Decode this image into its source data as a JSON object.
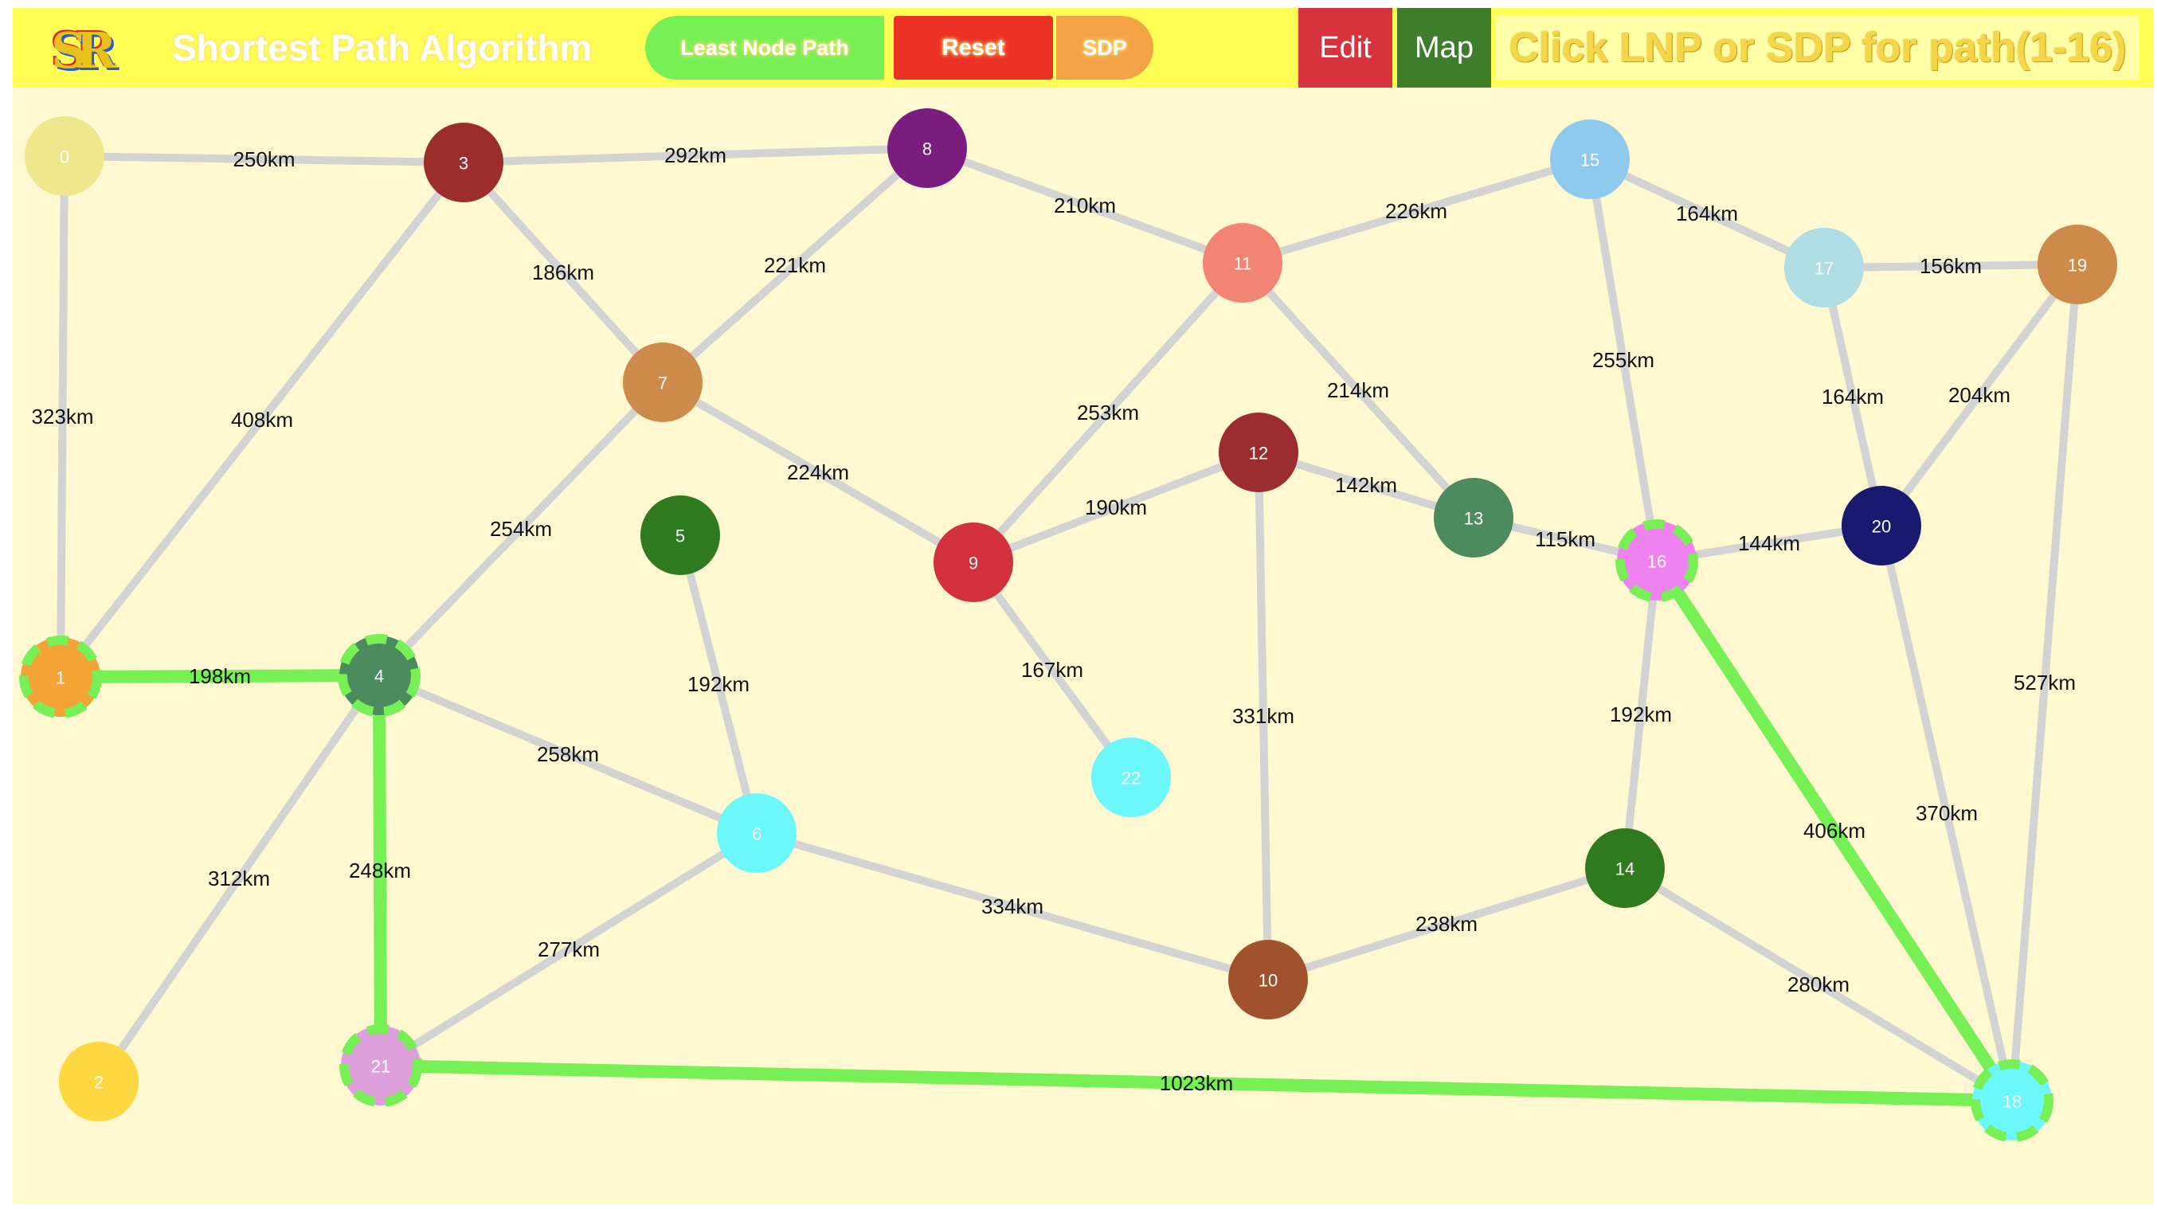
{
  "app": {
    "logo_text": "SR",
    "title": "Shortest Path Algorithm"
  },
  "toolbar": {
    "lnp_label": "Least Node Path",
    "reset_label": "Reset",
    "sdp_label": "SDP",
    "edit_label": "Edit",
    "map_label": "Map",
    "status_text": "Click LNP or SDP for path(1-16)"
  },
  "colors": {
    "toolbar_bg": "#ffff55",
    "canvas_bg": "#fff8d0",
    "edge": "#d3d3d3",
    "path_highlight": "#77f055"
  },
  "graph": {
    "nodes": [
      {
        "id": "0",
        "label": "0",
        "color": "#f0e68c"
      },
      {
        "id": "1",
        "label": "1",
        "color": "#f4a437",
        "highlight": true
      },
      {
        "id": "2",
        "label": "2",
        "color": "#ffd740"
      },
      {
        "id": "3",
        "label": "3",
        "color": "#9b2d2d"
      },
      {
        "id": "4",
        "label": "4",
        "color": "#4b8b5d",
        "highlight": true
      },
      {
        "id": "5",
        "label": "5",
        "color": "#2f7a1f"
      },
      {
        "id": "6",
        "label": "6",
        "color": "#6cf7fb"
      },
      {
        "id": "7",
        "label": "7",
        "color": "#cd8a4a"
      },
      {
        "id": "8",
        "label": "8",
        "color": "#7b1d7e"
      },
      {
        "id": "9",
        "label": "9",
        "color": "#d3313e"
      },
      {
        "id": "10",
        "label": "10",
        "color": "#a0522d"
      },
      {
        "id": "11",
        "label": "11",
        "color": "#f28474"
      },
      {
        "id": "12",
        "label": "12",
        "color": "#9b2c2f"
      },
      {
        "id": "13",
        "label": "13",
        "color": "#4b8b5d"
      },
      {
        "id": "14",
        "label": "14",
        "color": "#2f7a1f"
      },
      {
        "id": "15",
        "label": "15",
        "color": "#8ecaee"
      },
      {
        "id": "16",
        "label": "16",
        "color": "#ee82ee",
        "highlight": true
      },
      {
        "id": "17",
        "label": "17",
        "color": "#aedde6"
      },
      {
        "id": "18",
        "label": "18",
        "color": "#6cf7fb",
        "highlight": true
      },
      {
        "id": "19",
        "label": "19",
        "color": "#cd8a4a"
      },
      {
        "id": "20",
        "label": "20",
        "color": "#191970"
      },
      {
        "id": "21",
        "label": "21",
        "color": "#dda0dd",
        "highlight": true
      },
      {
        "id": "22",
        "label": "22",
        "color": "#6cf7fb"
      }
    ],
    "edges": [
      {
        "from": "0",
        "to": "3",
        "label": "250km"
      },
      {
        "from": "0",
        "to": "1",
        "label": "323km"
      },
      {
        "from": "3",
        "to": "8",
        "label": "292km"
      },
      {
        "from": "3",
        "to": "7",
        "label": "186km"
      },
      {
        "from": "3",
        "to": "1",
        "label": "408km"
      },
      {
        "from": "8",
        "to": "7",
        "label": "221km"
      },
      {
        "from": "8",
        "to": "11",
        "label": "210km"
      },
      {
        "from": "11",
        "to": "15",
        "label": "226km"
      },
      {
        "from": "15",
        "to": "17",
        "label": "164km"
      },
      {
        "from": "17",
        "to": "19",
        "label": "156km"
      },
      {
        "from": "15",
        "to": "16",
        "label": "255km"
      },
      {
        "from": "11",
        "to": "13",
        "label": "214km"
      },
      {
        "from": "11",
        "to": "9",
        "label": "253km"
      },
      {
        "from": "7",
        "to": "9",
        "label": "224km"
      },
      {
        "from": "7",
        "to": "4",
        "label": "254km"
      },
      {
        "from": "9",
        "to": "12",
        "label": "190km"
      },
      {
        "from": "12",
        "to": "13",
        "label": "142km"
      },
      {
        "from": "13",
        "to": "16",
        "label": "115km"
      },
      {
        "from": "16",
        "to": "20",
        "label": "144km"
      },
      {
        "from": "17",
        "to": "20",
        "label": "164km"
      },
      {
        "from": "19",
        "to": "20",
        "label": "204km"
      },
      {
        "from": "19",
        "to": "18",
        "label": "527km"
      },
      {
        "from": "20",
        "to": "18",
        "label": "370km"
      },
      {
        "from": "16",
        "to": "18",
        "label": "406km",
        "highlight": true
      },
      {
        "from": "16",
        "to": "14",
        "label": "192km"
      },
      {
        "from": "14",
        "to": "18",
        "label": "280km"
      },
      {
        "from": "14",
        "to": "10",
        "label": "238km"
      },
      {
        "from": "12",
        "to": "10",
        "label": "331km"
      },
      {
        "from": "9",
        "to": "22",
        "label": "167km"
      },
      {
        "from": "5",
        "to": "6",
        "label": "192km"
      },
      {
        "from": "4",
        "to": "6",
        "label": "258km"
      },
      {
        "from": "6",
        "to": "10",
        "label": "334km"
      },
      {
        "from": "6",
        "to": "21",
        "label": "277km"
      },
      {
        "from": "1",
        "to": "4",
        "label": "198km",
        "highlight": true
      },
      {
        "from": "4",
        "to": "2",
        "label": "312km"
      },
      {
        "from": "4",
        "to": "21",
        "label": "248km",
        "highlight": true
      },
      {
        "from": "21",
        "to": "18",
        "label": "1023km",
        "highlight": true
      }
    ]
  }
}
